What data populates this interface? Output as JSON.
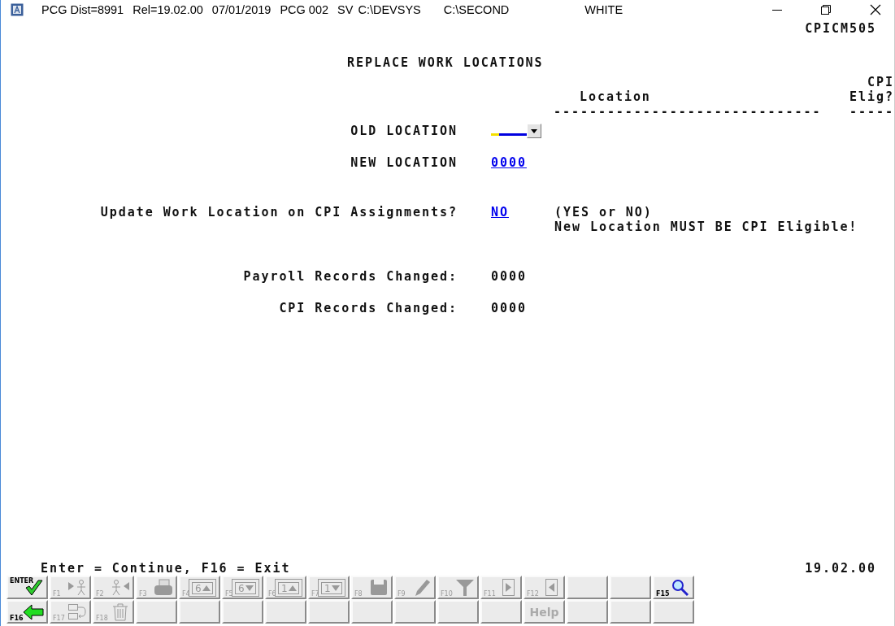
{
  "title_bar": {
    "items": [
      "PCG Dist=8991",
      "Rel=19.02.00",
      "07/01/2019",
      "PCG 002",
      "SV",
      "C:\\DEVSYS",
      "C:\\SECOND"
    ],
    "user": "WHITE"
  },
  "screen_id": "CPICM505",
  "heading": "REPLACE WORK LOCATIONS",
  "location_list": {
    "columns": [
      {
        "label": "Location",
        "rule": "------------------------------"
      },
      {
        "label": "CPI Elig?",
        "rule": "-----"
      }
    ]
  },
  "fields": [
    {
      "kind": "dropdown",
      "label": "OLD LOCATION"
    },
    {
      "kind": "link",
      "label": "NEW LOCATION",
      "value": "0000"
    },
    {
      "kind": "link",
      "label": "Update Work Location on CPI Assignments?",
      "value": "NO",
      "notes": [
        "(YES or NO)",
        "New Location MUST BE CPI Eligible!"
      ]
    },
    {
      "kind": "readonly",
      "label": "Payroll Records Changed:",
      "value": "0000"
    },
    {
      "kind": "readonly",
      "label": "CPI Records Changed:",
      "value": "0000"
    }
  ],
  "footer": {
    "hint": "Enter = Continue, F16 = Exit",
    "version": "19.02.00"
  },
  "toolbar": [
    [
      {
        "kind": "check",
        "label": "ENTER",
        "disabled": false
      },
      {
        "kind": "walk-right",
        "label": "F1",
        "disabled": true
      },
      {
        "kind": "walk-left",
        "label": "F2",
        "disabled": true
      },
      {
        "kind": "printer",
        "label": "F3",
        "disabled": true
      },
      {
        "kind": "page-up",
        "label": "F4",
        "page": "6",
        "disabled": true
      },
      {
        "kind": "page-down",
        "label": "F5",
        "page": "6",
        "disabled": true
      },
      {
        "kind": "page-up",
        "label": "F6",
        "page": "1",
        "disabled": true
      },
      {
        "kind": "page-down",
        "label": "F7",
        "page": "1",
        "disabled": true
      },
      {
        "kind": "disk",
        "label": "F8",
        "disabled": true
      },
      {
        "kind": "pencil",
        "label": "F9",
        "disabled": true
      },
      {
        "kind": "funnel",
        "label": "F10",
        "disabled": true
      },
      {
        "kind": "play-right",
        "label": "F11",
        "disabled": true
      },
      {
        "kind": "play-left",
        "label": "F12",
        "disabled": true
      },
      {
        "kind": "blank"
      },
      {
        "kind": "blank"
      },
      {
        "kind": "magnifier",
        "label": "F15",
        "disabled": false
      }
    ],
    [
      {
        "kind": "arrow-left",
        "label": "F16",
        "disabled": false
      },
      {
        "kind": "swap",
        "label": "F17",
        "disabled": true
      },
      {
        "kind": "trash",
        "label": "F18",
        "disabled": true
      },
      {
        "kind": "blank"
      },
      {
        "kind": "blank"
      },
      {
        "kind": "blank"
      },
      {
        "kind": "blank"
      },
      {
        "kind": "blank"
      },
      {
        "kind": "blank"
      },
      {
        "kind": "blank"
      },
      {
        "kind": "blank"
      },
      {
        "kind": "blank"
      },
      {
        "kind": "text",
        "label": "Help",
        "disabled": true
      },
      {
        "kind": "blank"
      },
      {
        "kind": "blank"
      },
      {
        "kind": "blank"
      }
    ]
  ]
}
